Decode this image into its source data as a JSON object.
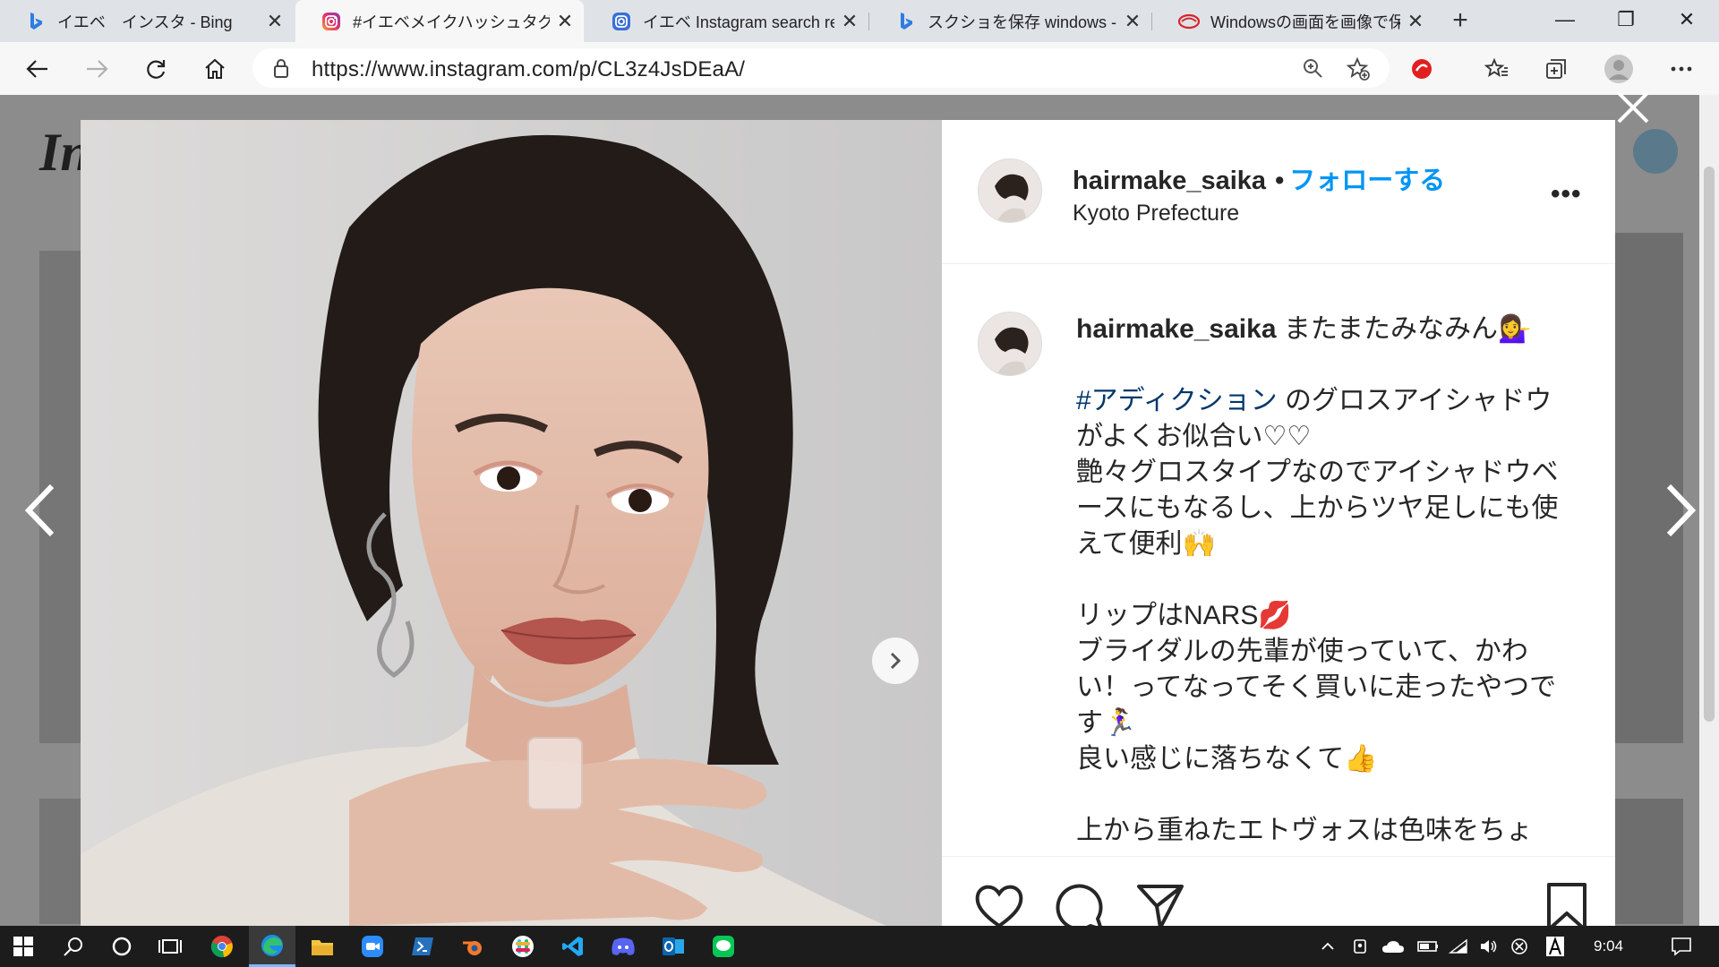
{
  "browser": {
    "tabs": [
      {
        "title": "イエベ　インスタ - Bing",
        "icon": "bing-icon",
        "active": false
      },
      {
        "title": "#イエベメイクハッシュタグ - Inst",
        "icon": "instagram-icon",
        "active": true
      },
      {
        "title": "イエベ Instagram search resu",
        "icon": "instagram-icon",
        "active": false
      },
      {
        "title": "スクショを保存 windows - Bin",
        "icon": "bing-icon",
        "active": false
      },
      {
        "title": "Windowsの画面を画像で保存",
        "icon": "site-icon",
        "active": false
      }
    ],
    "url": "https://www.instagram.com/p/CL3z4JsDEaA/"
  },
  "page": {
    "logo_text": "In"
  },
  "post": {
    "username": "hairmake_saika",
    "separator": "•",
    "follow_label": "フォローする",
    "location": "Kyoto Prefecture",
    "more_label": "•••",
    "caption": {
      "username": "hairmake_saika",
      "intro": "またまたみなみん💁‍♀️",
      "hashtag": "#アディクション",
      "line1_rest": "のグロスアイシャドウがよくお似合い♡♡",
      "line2": "艶々グロスタイプなのでアイシャドウベースにもなるし、上からツヤ足しにも使えて便利🙌",
      "line3": "リップはNARS💋",
      "line4": "ブライダルの先輩が使っていて、かわい！ってなってそく買いに走ったやつです🏃‍♀️",
      "line5": "良い感じに落ちなくて👍",
      "line6": "上から重ねたエトヴォスは色味をちょ"
    }
  },
  "taskbar": {
    "clock": "9:04"
  },
  "colors": {
    "follow": "#0095f6",
    "hashtag": "#00376b",
    "taskbar": "#1c1c1c",
    "tabstrip": "#dfe3e8"
  }
}
